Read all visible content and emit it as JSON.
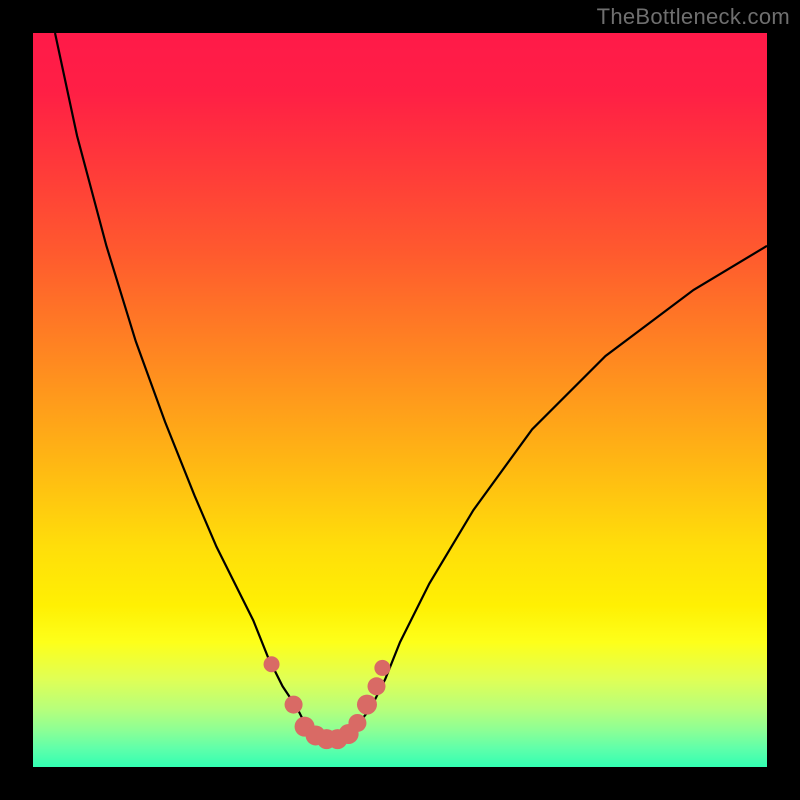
{
  "watermark": "TheBottleneck.com",
  "colors": {
    "gradient_stops": [
      {
        "offset": 0.0,
        "color": "#ff1a49"
      },
      {
        "offset": 0.08,
        "color": "#ff1f45"
      },
      {
        "offset": 0.18,
        "color": "#ff393a"
      },
      {
        "offset": 0.3,
        "color": "#ff5a2e"
      },
      {
        "offset": 0.45,
        "color": "#ff8a20"
      },
      {
        "offset": 0.58,
        "color": "#ffb514"
      },
      {
        "offset": 0.7,
        "color": "#ffde0a"
      },
      {
        "offset": 0.78,
        "color": "#fff003"
      },
      {
        "offset": 0.83,
        "color": "#fdff1a"
      },
      {
        "offset": 0.88,
        "color": "#e0ff55"
      },
      {
        "offset": 0.92,
        "color": "#b8ff7a"
      },
      {
        "offset": 0.95,
        "color": "#8cff95"
      },
      {
        "offset": 0.975,
        "color": "#5fffaa"
      },
      {
        "offset": 1.0,
        "color": "#32ffb2"
      }
    ],
    "curve": "#000000",
    "markers": "#d96a65",
    "background": "#000000"
  },
  "chart_data": {
    "type": "line",
    "title": "",
    "xlabel": "",
    "ylabel": "",
    "xlim": [
      0,
      100
    ],
    "ylim": [
      0,
      100
    ],
    "grid": false,
    "legend": false,
    "series": [
      {
        "name": "bottleneck-curve",
        "x": [
          3,
          6,
          10,
          14,
          18,
          22,
          25,
          28,
          30,
          32,
          34,
          36,
          37,
          38,
          39.5,
          41,
          42.5,
          44,
          46,
          48,
          50,
          54,
          60,
          68,
          78,
          90,
          100
        ],
        "y": [
          100,
          86,
          71,
          58,
          47,
          37,
          30,
          24,
          20,
          15,
          11,
          8,
          6,
          5,
          4,
          4,
          4.5,
          5.5,
          8,
          12,
          17,
          25,
          35,
          46,
          56,
          65,
          71
        ]
      }
    ],
    "markers": {
      "name": "highlight-points",
      "x": [
        32.5,
        35.5,
        37,
        38.5,
        40,
        41.5,
        43,
        44.2,
        45.5,
        46.8,
        47.6
      ],
      "y": [
        14,
        8.5,
        5.5,
        4.3,
        3.8,
        3.8,
        4.5,
        6,
        8.5,
        11,
        13.5
      ],
      "r": [
        8,
        9,
        10,
        10,
        10,
        10,
        10,
        9,
        10,
        9,
        8
      ]
    }
  }
}
